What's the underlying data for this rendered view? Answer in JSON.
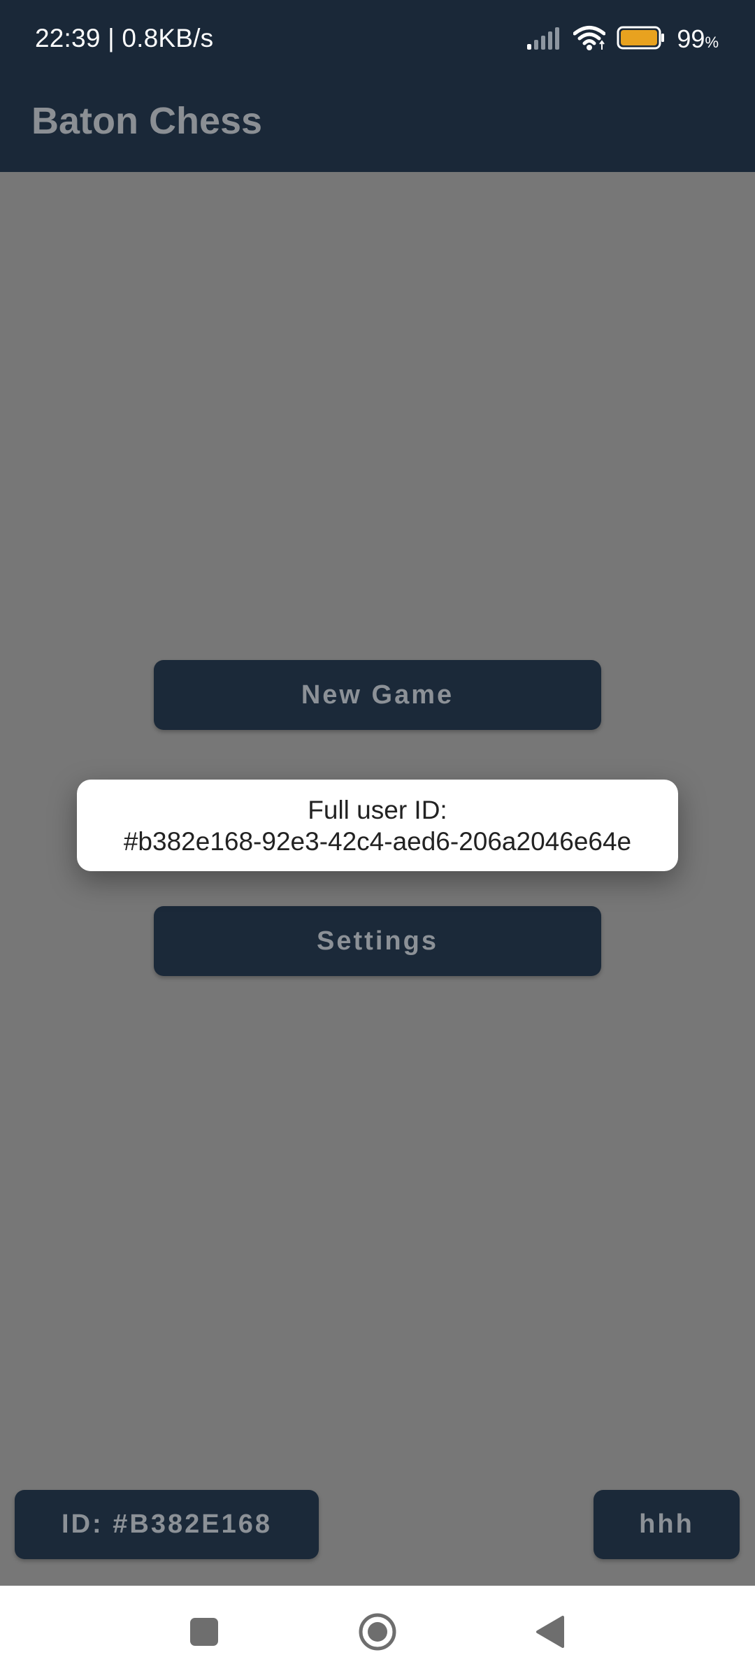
{
  "status_bar": {
    "time_speed": "22:39 | 0.8KB/s",
    "battery_percent": "99",
    "battery_unit": "%",
    "icons": [
      "signal-icon",
      "wifi-icon",
      "battery-icon"
    ],
    "battery_color": "#e8a21f"
  },
  "app_bar": {
    "title": "Baton Chess"
  },
  "main": {
    "new_game_label": "New Game",
    "settings_label": "Settings"
  },
  "popup": {
    "line1": "Full user ID:",
    "line2": "#b382e168-92e3-42c4-aed6-206a2046e64e"
  },
  "bottom": {
    "id_label": "ID: #B382E168",
    "hhh_label": "hhh"
  },
  "nav_bar": {
    "icons": [
      "recents-square-icon",
      "home-circle-icon",
      "back-triangle-icon"
    ]
  },
  "colors": {
    "dark_navy": "#1a2838",
    "overlay_gray": "#777777",
    "button_text": "#8c9197"
  }
}
